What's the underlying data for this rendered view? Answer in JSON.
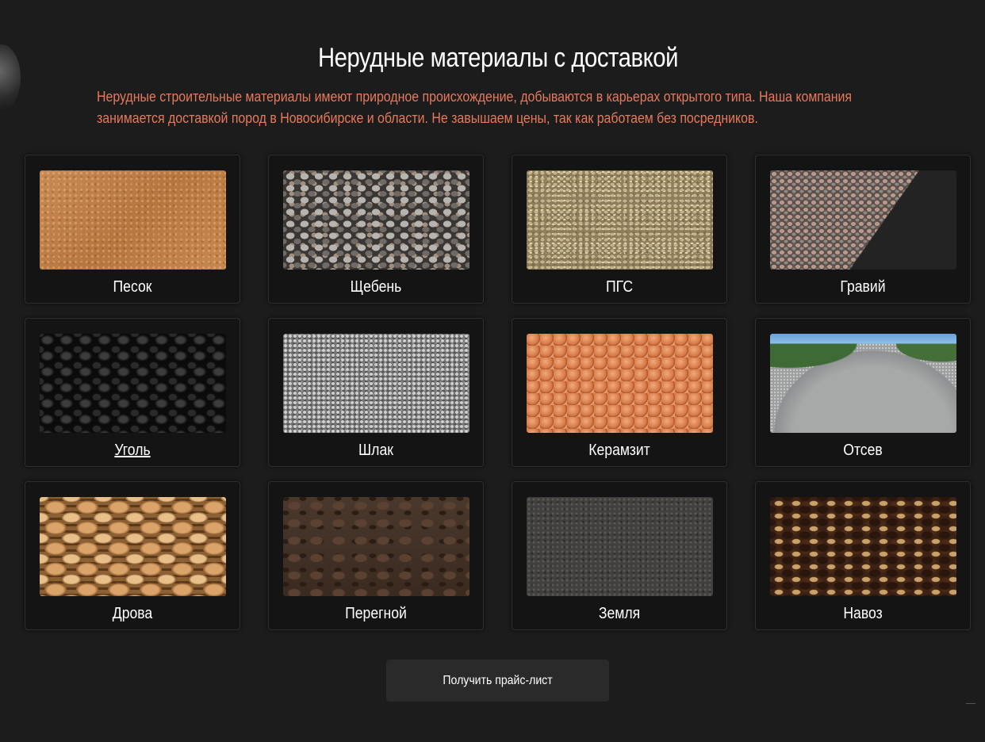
{
  "section": {
    "title": "Нерудные материалы с доставкой",
    "description": "Нерудные строительные материалы имеют природное происхождение, добываются в карьерах открытого типа. Наша компания занимается доставкой пород в Новосибирске и области. Не завышаем цены, так как работаем без посредников."
  },
  "materials": [
    {
      "label": "Песок"
    },
    {
      "label": "Щебень"
    },
    {
      "label": "ПГС"
    },
    {
      "label": "Гравий"
    },
    {
      "label": "Уголь"
    },
    {
      "label": "Шлак"
    },
    {
      "label": "Керамзит"
    },
    {
      "label": "Отсев"
    },
    {
      "label": "Дрова"
    },
    {
      "label": "Перегной"
    },
    {
      "label": "Земля"
    },
    {
      "label": "Навоз"
    }
  ],
  "price_button": {
    "label": "Получить прайс-лист"
  },
  "colors": {
    "background": "#1c1c1c",
    "card": "#141414",
    "accent_text": "#e8785a",
    "button": "#2a2a2a"
  }
}
